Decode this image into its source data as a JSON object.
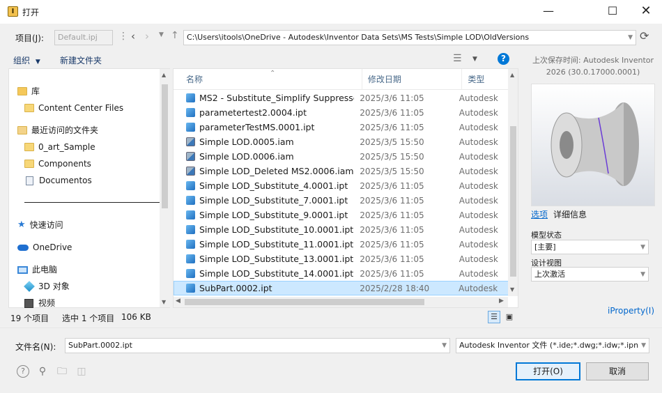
{
  "window": {
    "title": "打开"
  },
  "toolbar": {
    "project_label": "项目(J):",
    "project_value": "Default.ipj",
    "path": "C:\\Users\\itools\\OneDrive - Autodesk\\Inventor Data Sets\\MS Tests\\Simple LOD\\OldVersions",
    "organize_label": "组织",
    "new_folder_label": "新建文件夹"
  },
  "nav": {
    "items": [
      {
        "label": "库",
        "level": 0,
        "icon": "library-folder-icon"
      },
      {
        "label": "Content Center Files",
        "level": 1,
        "icon": "folder-icon"
      },
      {
        "label": "最近访问的文件夹",
        "level": 0,
        "icon": "recent-folder-icon"
      },
      {
        "label": "0_art_Sample",
        "level": 1,
        "icon": "folder-icon"
      },
      {
        "label": "Components",
        "level": 1,
        "icon": "folder-icon"
      },
      {
        "label": "Documentos",
        "level": 1,
        "icon": "document-icon"
      },
      {
        "label": "快速访问",
        "level": 0,
        "icon": "star-icon"
      },
      {
        "label": "OneDrive",
        "level": 0,
        "icon": "cloud-icon"
      },
      {
        "label": "此电脑",
        "level": 0,
        "icon": "computer-icon"
      },
      {
        "label": "3D 对象",
        "level": 1,
        "icon": "cube-icon"
      },
      {
        "label": "视频",
        "level": 1,
        "icon": "video-icon"
      }
    ]
  },
  "list": {
    "columns": {
      "name": "名称",
      "date": "修改日期",
      "type": "类型"
    },
    "rows": [
      {
        "name": "MS2 - Substitute_Simplify Suppresse...",
        "date": "2025/3/6 11:05",
        "type": "Autodesk",
        "kind": "ipt"
      },
      {
        "name": "parametertest2.0004.ipt",
        "date": "2025/3/6 11:05",
        "type": "Autodesk",
        "kind": "ipt"
      },
      {
        "name": "parameterTestMS.0001.ipt",
        "date": "2025/3/6 11:05",
        "type": "Autodesk",
        "kind": "ipt"
      },
      {
        "name": "Simple LOD.0005.iam",
        "date": "2025/3/5 15:50",
        "type": "Autodesk",
        "kind": "iam"
      },
      {
        "name": "Simple LOD.0006.iam",
        "date": "2025/3/5 15:50",
        "type": "Autodesk",
        "kind": "iam"
      },
      {
        "name": "Simple LOD_Deleted MS2.0006.iam",
        "date": "2025/3/5 15:50",
        "type": "Autodesk",
        "kind": "iam"
      },
      {
        "name": "Simple LOD_Substitute_4.0001.ipt",
        "date": "2025/3/6 11:05",
        "type": "Autodesk",
        "kind": "ipt"
      },
      {
        "name": "Simple LOD_Substitute_7.0001.ipt",
        "date": "2025/3/6 11:05",
        "type": "Autodesk",
        "kind": "ipt"
      },
      {
        "name": "Simple LOD_Substitute_9.0001.ipt",
        "date": "2025/3/6 11:05",
        "type": "Autodesk",
        "kind": "ipt"
      },
      {
        "name": "Simple LOD_Substitute_10.0001.ipt",
        "date": "2025/3/6 11:05",
        "type": "Autodesk",
        "kind": "ipt"
      },
      {
        "name": "Simple LOD_Substitute_11.0001.ipt",
        "date": "2025/3/6 11:05",
        "type": "Autodesk",
        "kind": "ipt"
      },
      {
        "name": "Simple LOD_Substitute_13.0001.ipt",
        "date": "2025/3/6 11:05",
        "type": "Autodesk",
        "kind": "ipt"
      },
      {
        "name": "Simple LOD_Substitute_14.0001.ipt",
        "date": "2025/3/6 11:05",
        "type": "Autodesk",
        "kind": "ipt"
      },
      {
        "name": "SubPart.0002.ipt",
        "date": "2025/2/28 18:40",
        "type": "Autodesk",
        "kind": "ipt",
        "selected": true
      }
    ]
  },
  "preview": {
    "saved_info": "上次保存时间: Autodesk Inventor 2026 (30.0.17000.0001)",
    "tab_options": "选项",
    "tab_details": "详细信息",
    "model_state_label": "模型状态",
    "model_state_value": "[主要]",
    "design_view_label": "设计视图",
    "design_view_value": "上次激活",
    "iproperty_link": "iProperty(I)"
  },
  "status": {
    "item_count": "19 个项目",
    "selected": "选中 1 个项目",
    "size": "106 KB"
  },
  "bottom": {
    "filename_label": "文件名(N):",
    "filename_value": "SubPart.0002.ipt",
    "filetype_value": "Autodesk Inventor 文件 (*.ide;*.dwg;*.idw;*.ipn;...",
    "open_label": "打开(O)",
    "cancel_label": "取消"
  },
  "colors": {
    "accent": "#0078d7",
    "selection": "#cce8ff",
    "link": "#0066cc"
  }
}
